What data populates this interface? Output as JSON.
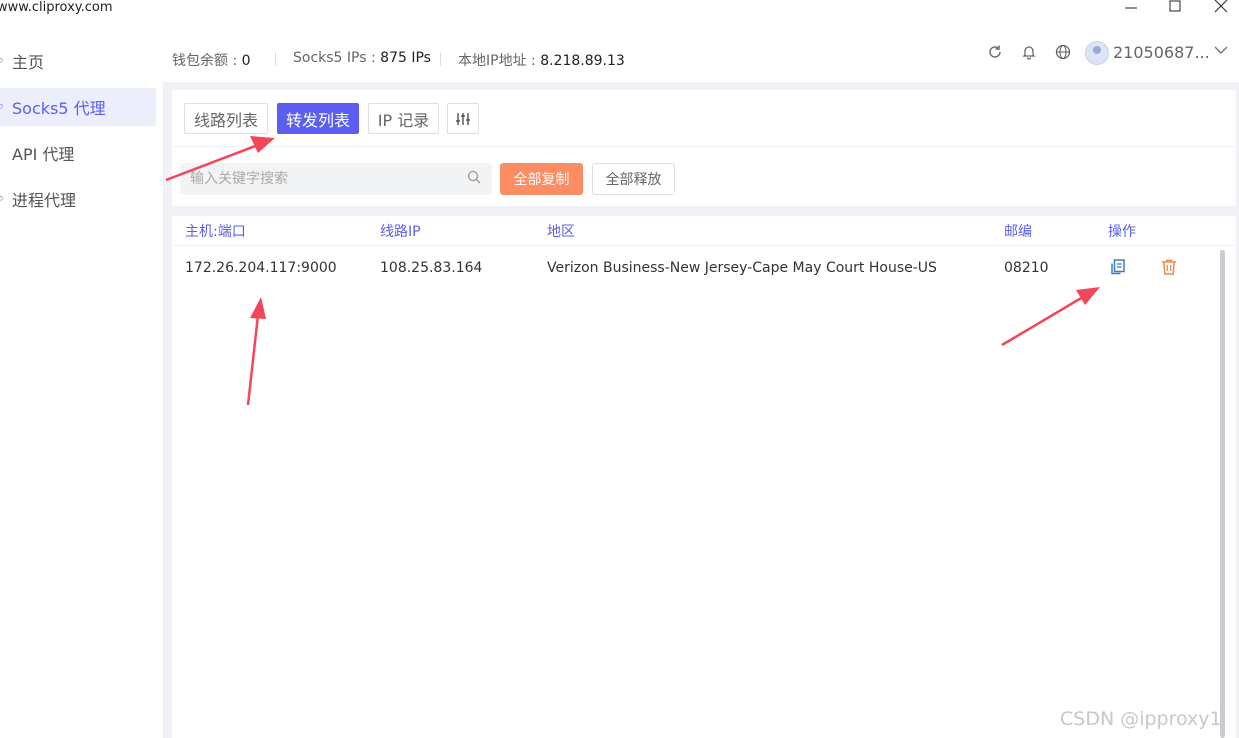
{
  "window": {
    "url": "www.cliproxy.com"
  },
  "sidebar": {
    "items": [
      {
        "label": "主页",
        "icon": "home-icon",
        "active": false
      },
      {
        "label": "Socks5 代理",
        "icon": "socks5-icon",
        "active": true
      },
      {
        "label": "API 代理",
        "icon": "api-icon",
        "active": false
      },
      {
        "label": "进程代理",
        "icon": "process-icon",
        "active": false
      }
    ]
  },
  "topbar": {
    "wallet_label": "钱包余额 :",
    "wallet_value": "0",
    "socks_label": "Socks5 IPs :",
    "socks_value": "875 IPs",
    "local_ip_label": "本地IP地址 :",
    "local_ip_value": "8.218.89.13",
    "username": "21050687..."
  },
  "tabs": [
    {
      "label": "线路列表",
      "active": false
    },
    {
      "label": "转发列表",
      "active": true
    },
    {
      "label": "IP 记录",
      "active": false
    }
  ],
  "toolbar": {
    "search_placeholder": "输入关键字搜索",
    "copy_all_label": "全部复制",
    "release_all_label": "全部释放"
  },
  "table": {
    "columns": [
      "主机:端口",
      "线路IP",
      "地区",
      "邮编",
      "操作"
    ],
    "rows": [
      {
        "host_port": "172.26.204.117:9000",
        "line_ip": "108.25.83.164",
        "region": "Verizon Business-New Jersey-Cape May Court House-US",
        "zip": "08210"
      }
    ]
  },
  "watermark": "CSDN @ipproxy1",
  "colors": {
    "accent": "#5b5ef0",
    "copy_all_button": "#fb8c63",
    "copy_icon": "#3a7bd5",
    "delete_icon": "#f08a4b",
    "annotation_arrow": "#f2475b"
  }
}
